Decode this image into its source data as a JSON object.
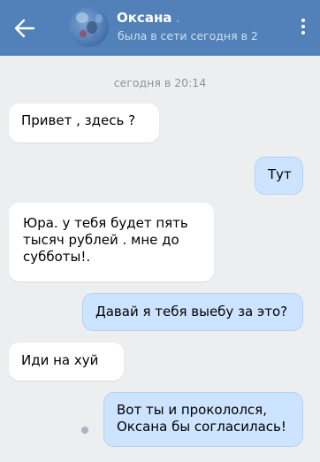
{
  "header": {
    "contact_name": "Оксана",
    "contact_name_suffix": " . ",
    "status": "была в сети сегодня в 2",
    "back_icon": "arrow-left-icon",
    "menu_icon": "more-vertical-icon",
    "background_color": "#5181b8"
  },
  "chat": {
    "date_separator": "сегодня в 20:14",
    "messages": [
      {
        "direction": "incoming",
        "text": "Привет , здесь ?"
      },
      {
        "direction": "outgoing",
        "text": "Тут"
      },
      {
        "direction": "incoming",
        "text": "Юра. у тебя будет пять тысяч рублей . мне до субботы!."
      },
      {
        "direction": "outgoing",
        "text": "Давай я тебя выебу за это?"
      },
      {
        "direction": "incoming",
        "text": "Иди на хуй"
      },
      {
        "direction": "outgoing",
        "text": "Вот ты и прокололся, Оксана бы согласилась!",
        "unread": true
      }
    ],
    "incoming_color": "#ffffff",
    "outgoing_color": "#cce4ff",
    "background_color": "#edeef0"
  }
}
